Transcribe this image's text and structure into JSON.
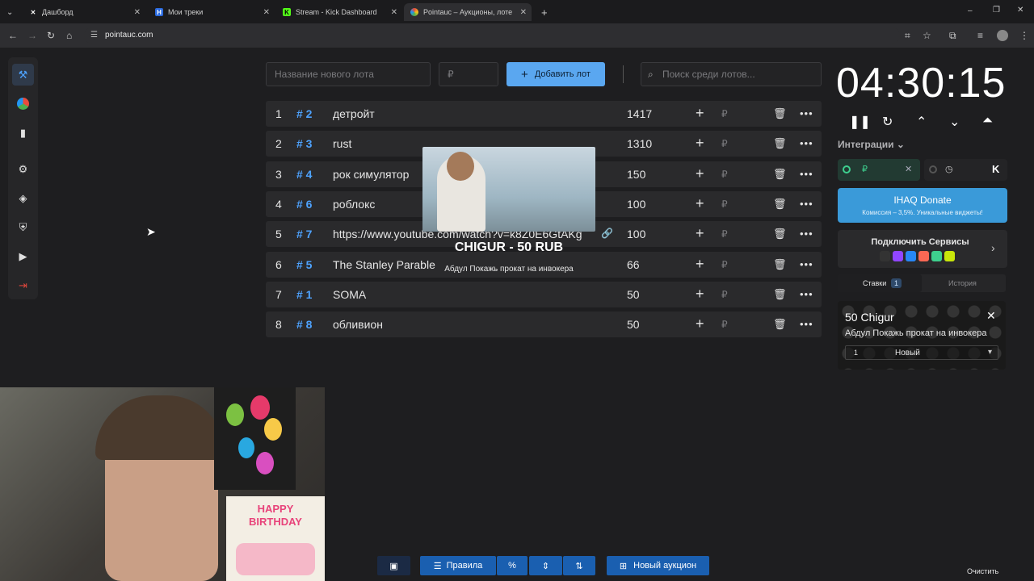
{
  "browser": {
    "tabs": [
      {
        "title": "Дашборд",
        "icon": "x-logo-icon"
      },
      {
        "title": "Мои треки",
        "icon": "tracks-icon"
      },
      {
        "title": "Stream - Kick Dashboard",
        "icon": "kick-icon"
      },
      {
        "title": "Pointauc – Аукционы, лотереи",
        "icon": "pointauc-icon"
      }
    ],
    "url": "pointauc.com"
  },
  "toolbar": {
    "new_lot_placeholder": "Название нового лота",
    "amount_placeholder": "₽",
    "add_label": "Добавить лот",
    "search_placeholder": "Поиск среди лотов..."
  },
  "lots": [
    {
      "num": "1",
      "id": "# 2",
      "name": "детройт",
      "amount": "1417"
    },
    {
      "num": "2",
      "id": "# 3",
      "name": "rust",
      "amount": "1310"
    },
    {
      "num": "3",
      "id": "# 4",
      "name": "рок симулятор",
      "amount": "150"
    },
    {
      "num": "4",
      "id": "# 6",
      "name": "роблокс",
      "amount": "100"
    },
    {
      "num": "5",
      "id": "# 7",
      "name": "https://www.youtube.com/watch?v=k8Z0E6GtAKg",
      "amount": "100"
    },
    {
      "num": "6",
      "id": "# 5",
      "name": "The Stanley Parable",
      "amount": "66"
    },
    {
      "num": "7",
      "id": "# 1",
      "name": "SOMA",
      "amount": "50"
    },
    {
      "num": "8",
      "id": "# 8",
      "name": "обливион",
      "amount": "50"
    }
  ],
  "lot_currency": "₽",
  "donation": {
    "title": "CHIGUR - 50 RUB",
    "message": "Абдул Покажь прокат на инвокера"
  },
  "timer": "04:30:15",
  "integrations": {
    "label": "Интеграции",
    "iq_title": "IHAQ Donate",
    "iq_sub": "Комиссия – 3,5%. Уникальные виджеты!",
    "services_label": "Подключить Сервисы"
  },
  "bids": {
    "tab_bids": "Ставки",
    "bids_count": "1",
    "tab_history": "История",
    "card_title": "50 Chigur",
    "card_message": "Абдул Покажь прокат на инвокера",
    "card_index": "1",
    "card_status": "Новый"
  },
  "bottom": {
    "rules_label": "Правила",
    "percent_label": "%",
    "new_auction_label": "Новый аукцион",
    "clear_label": "Очистить"
  },
  "cam": {
    "bday_text": "HAPPY BIRTHDAY"
  },
  "colors": {
    "accent": "#4ea3ff",
    "primary_btn": "#5aa7f0",
    "bottom_btn": "#1a5fb0",
    "background": "#1e1e20"
  }
}
